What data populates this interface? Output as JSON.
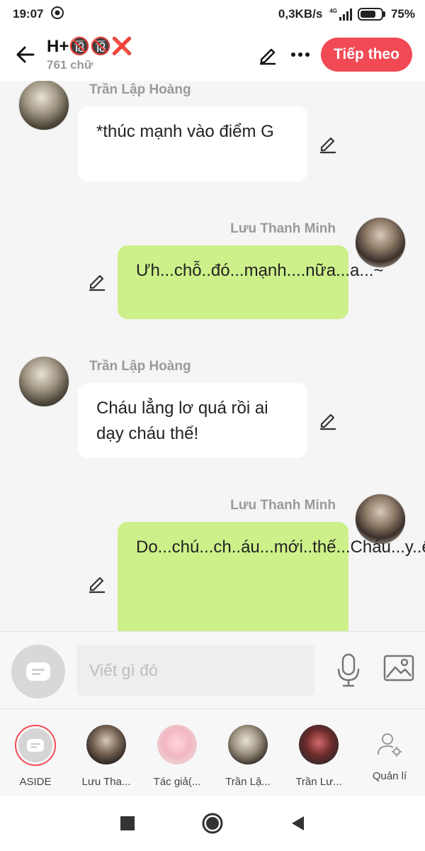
{
  "status_bar": {
    "time": "19:07",
    "net_speed": "0,3KB/s",
    "network": "4G",
    "battery": "75%",
    "battery_level": 0.75
  },
  "header": {
    "title": "H+🔞🔞❌",
    "word_count": "761 chữ",
    "next_label": "Tiếp theo"
  },
  "messages": [
    {
      "sender": "Trần Lập Hoàng",
      "side": "left",
      "text": "*thúc mạnh vào điểm G"
    },
    {
      "sender": "Lưu Thanh Minh",
      "side": "right",
      "text": "Ưh...chỗ..đó...mạnh....nữa...a...~"
    },
    {
      "sender": "Trần Lập Hoàng",
      "side": "left",
      "text": "Cháu lẳng lơ quá rồi ai dạy cháu thế!"
    },
    {
      "sender": "Lưu Thanh Minh",
      "side": "right",
      "text": "Do...chú...ch..áu...mới..thế...Cháu...y..êu..chú...ưm...ah..ha...sướn..g..ưm~"
    }
  ],
  "input": {
    "placeholder": "Viết gì đó"
  },
  "characters": [
    {
      "label": "ASIDE"
    },
    {
      "label": "Lưu Tha..."
    },
    {
      "label": "Tác giả(..."
    },
    {
      "label": "Trần Lậ..."
    },
    {
      "label": "Trần Lư..."
    }
  ],
  "manage_label": "Quản lí",
  "colors": {
    "accent": "#f24a55",
    "right_bubble": "#cdf08a",
    "left_bubble": "#ffffff"
  }
}
